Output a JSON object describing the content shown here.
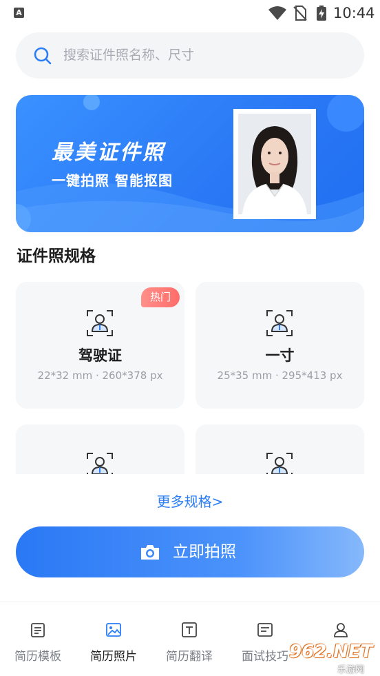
{
  "status_bar": {
    "time": "10:44",
    "app_icon_letter": "A"
  },
  "search": {
    "placeholder": "搜索证件照名称、尺寸"
  },
  "banner": {
    "title": "最美证件照",
    "subtitle": "一键拍照  智能抠图"
  },
  "section": {
    "title": "证件照规格"
  },
  "specs": [
    {
      "name": "驾驶证",
      "size": "22*32 mm · 260*378 px",
      "badge": "热门"
    },
    {
      "name": "一寸",
      "size": "25*35 mm · 295*413 px"
    },
    {
      "name": "",
      "size": ""
    },
    {
      "name": "",
      "size": ""
    }
  ],
  "more_link": "更多规格>",
  "shoot_button": {
    "label": "立即拍照"
  },
  "nav": [
    {
      "label": "简历模板",
      "icon": "resume-template-icon"
    },
    {
      "label": "简历照片",
      "icon": "photo-icon",
      "active": true
    },
    {
      "label": "简历翻译",
      "icon": "translate-icon"
    },
    {
      "label": "面试技巧",
      "icon": "interview-icon"
    },
    {
      "label": "",
      "icon": "profile-icon"
    }
  ],
  "watermark": {
    "main": "962.NET",
    "sub": "乐游网"
  },
  "colors": {
    "accent": "#2a7df5",
    "hot": "#ff6d6a",
    "card_bg": "#f6f7f9"
  }
}
